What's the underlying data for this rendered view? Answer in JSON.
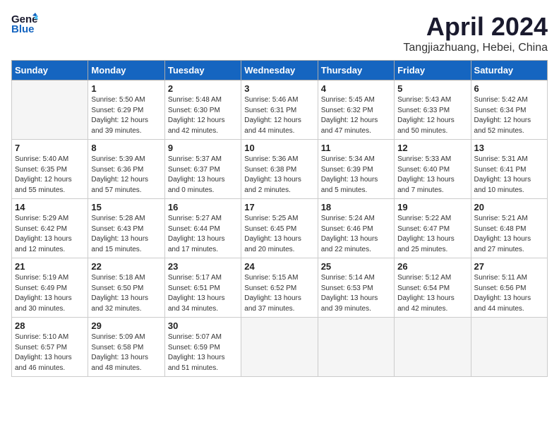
{
  "logo": {
    "line1": "General",
    "line2": "Blue"
  },
  "title": "April 2024",
  "subtitle": "Tangjiazhuang, Hebei, China",
  "days_of_week": [
    "Sunday",
    "Monday",
    "Tuesday",
    "Wednesday",
    "Thursday",
    "Friday",
    "Saturday"
  ],
  "weeks": [
    [
      {
        "day": "",
        "info": ""
      },
      {
        "day": "1",
        "info": "Sunrise: 5:50 AM\nSunset: 6:29 PM\nDaylight: 12 hours\nand 39 minutes."
      },
      {
        "day": "2",
        "info": "Sunrise: 5:48 AM\nSunset: 6:30 PM\nDaylight: 12 hours\nand 42 minutes."
      },
      {
        "day": "3",
        "info": "Sunrise: 5:46 AM\nSunset: 6:31 PM\nDaylight: 12 hours\nand 44 minutes."
      },
      {
        "day": "4",
        "info": "Sunrise: 5:45 AM\nSunset: 6:32 PM\nDaylight: 12 hours\nand 47 minutes."
      },
      {
        "day": "5",
        "info": "Sunrise: 5:43 AM\nSunset: 6:33 PM\nDaylight: 12 hours\nand 50 minutes."
      },
      {
        "day": "6",
        "info": "Sunrise: 5:42 AM\nSunset: 6:34 PM\nDaylight: 12 hours\nand 52 minutes."
      }
    ],
    [
      {
        "day": "7",
        "info": "Sunrise: 5:40 AM\nSunset: 6:35 PM\nDaylight: 12 hours\nand 55 minutes."
      },
      {
        "day": "8",
        "info": "Sunrise: 5:39 AM\nSunset: 6:36 PM\nDaylight: 12 hours\nand 57 minutes."
      },
      {
        "day": "9",
        "info": "Sunrise: 5:37 AM\nSunset: 6:37 PM\nDaylight: 13 hours\nand 0 minutes."
      },
      {
        "day": "10",
        "info": "Sunrise: 5:36 AM\nSunset: 6:38 PM\nDaylight: 13 hours\nand 2 minutes."
      },
      {
        "day": "11",
        "info": "Sunrise: 5:34 AM\nSunset: 6:39 PM\nDaylight: 13 hours\nand 5 minutes."
      },
      {
        "day": "12",
        "info": "Sunrise: 5:33 AM\nSunset: 6:40 PM\nDaylight: 13 hours\nand 7 minutes."
      },
      {
        "day": "13",
        "info": "Sunrise: 5:31 AM\nSunset: 6:41 PM\nDaylight: 13 hours\nand 10 minutes."
      }
    ],
    [
      {
        "day": "14",
        "info": "Sunrise: 5:29 AM\nSunset: 6:42 PM\nDaylight: 13 hours\nand 12 minutes."
      },
      {
        "day": "15",
        "info": "Sunrise: 5:28 AM\nSunset: 6:43 PM\nDaylight: 13 hours\nand 15 minutes."
      },
      {
        "day": "16",
        "info": "Sunrise: 5:27 AM\nSunset: 6:44 PM\nDaylight: 13 hours\nand 17 minutes."
      },
      {
        "day": "17",
        "info": "Sunrise: 5:25 AM\nSunset: 6:45 PM\nDaylight: 13 hours\nand 20 minutes."
      },
      {
        "day": "18",
        "info": "Sunrise: 5:24 AM\nSunset: 6:46 PM\nDaylight: 13 hours\nand 22 minutes."
      },
      {
        "day": "19",
        "info": "Sunrise: 5:22 AM\nSunset: 6:47 PM\nDaylight: 13 hours\nand 25 minutes."
      },
      {
        "day": "20",
        "info": "Sunrise: 5:21 AM\nSunset: 6:48 PM\nDaylight: 13 hours\nand 27 minutes."
      }
    ],
    [
      {
        "day": "21",
        "info": "Sunrise: 5:19 AM\nSunset: 6:49 PM\nDaylight: 13 hours\nand 30 minutes."
      },
      {
        "day": "22",
        "info": "Sunrise: 5:18 AM\nSunset: 6:50 PM\nDaylight: 13 hours\nand 32 minutes."
      },
      {
        "day": "23",
        "info": "Sunrise: 5:17 AM\nSunset: 6:51 PM\nDaylight: 13 hours\nand 34 minutes."
      },
      {
        "day": "24",
        "info": "Sunrise: 5:15 AM\nSunset: 6:52 PM\nDaylight: 13 hours\nand 37 minutes."
      },
      {
        "day": "25",
        "info": "Sunrise: 5:14 AM\nSunset: 6:53 PM\nDaylight: 13 hours\nand 39 minutes."
      },
      {
        "day": "26",
        "info": "Sunrise: 5:12 AM\nSunset: 6:54 PM\nDaylight: 13 hours\nand 42 minutes."
      },
      {
        "day": "27",
        "info": "Sunrise: 5:11 AM\nSunset: 6:56 PM\nDaylight: 13 hours\nand 44 minutes."
      }
    ],
    [
      {
        "day": "28",
        "info": "Sunrise: 5:10 AM\nSunset: 6:57 PM\nDaylight: 13 hours\nand 46 minutes."
      },
      {
        "day": "29",
        "info": "Sunrise: 5:09 AM\nSunset: 6:58 PM\nDaylight: 13 hours\nand 48 minutes."
      },
      {
        "day": "30",
        "info": "Sunrise: 5:07 AM\nSunset: 6:59 PM\nDaylight: 13 hours\nand 51 minutes."
      },
      {
        "day": "",
        "info": ""
      },
      {
        "day": "",
        "info": ""
      },
      {
        "day": "",
        "info": ""
      },
      {
        "day": "",
        "info": ""
      }
    ]
  ]
}
